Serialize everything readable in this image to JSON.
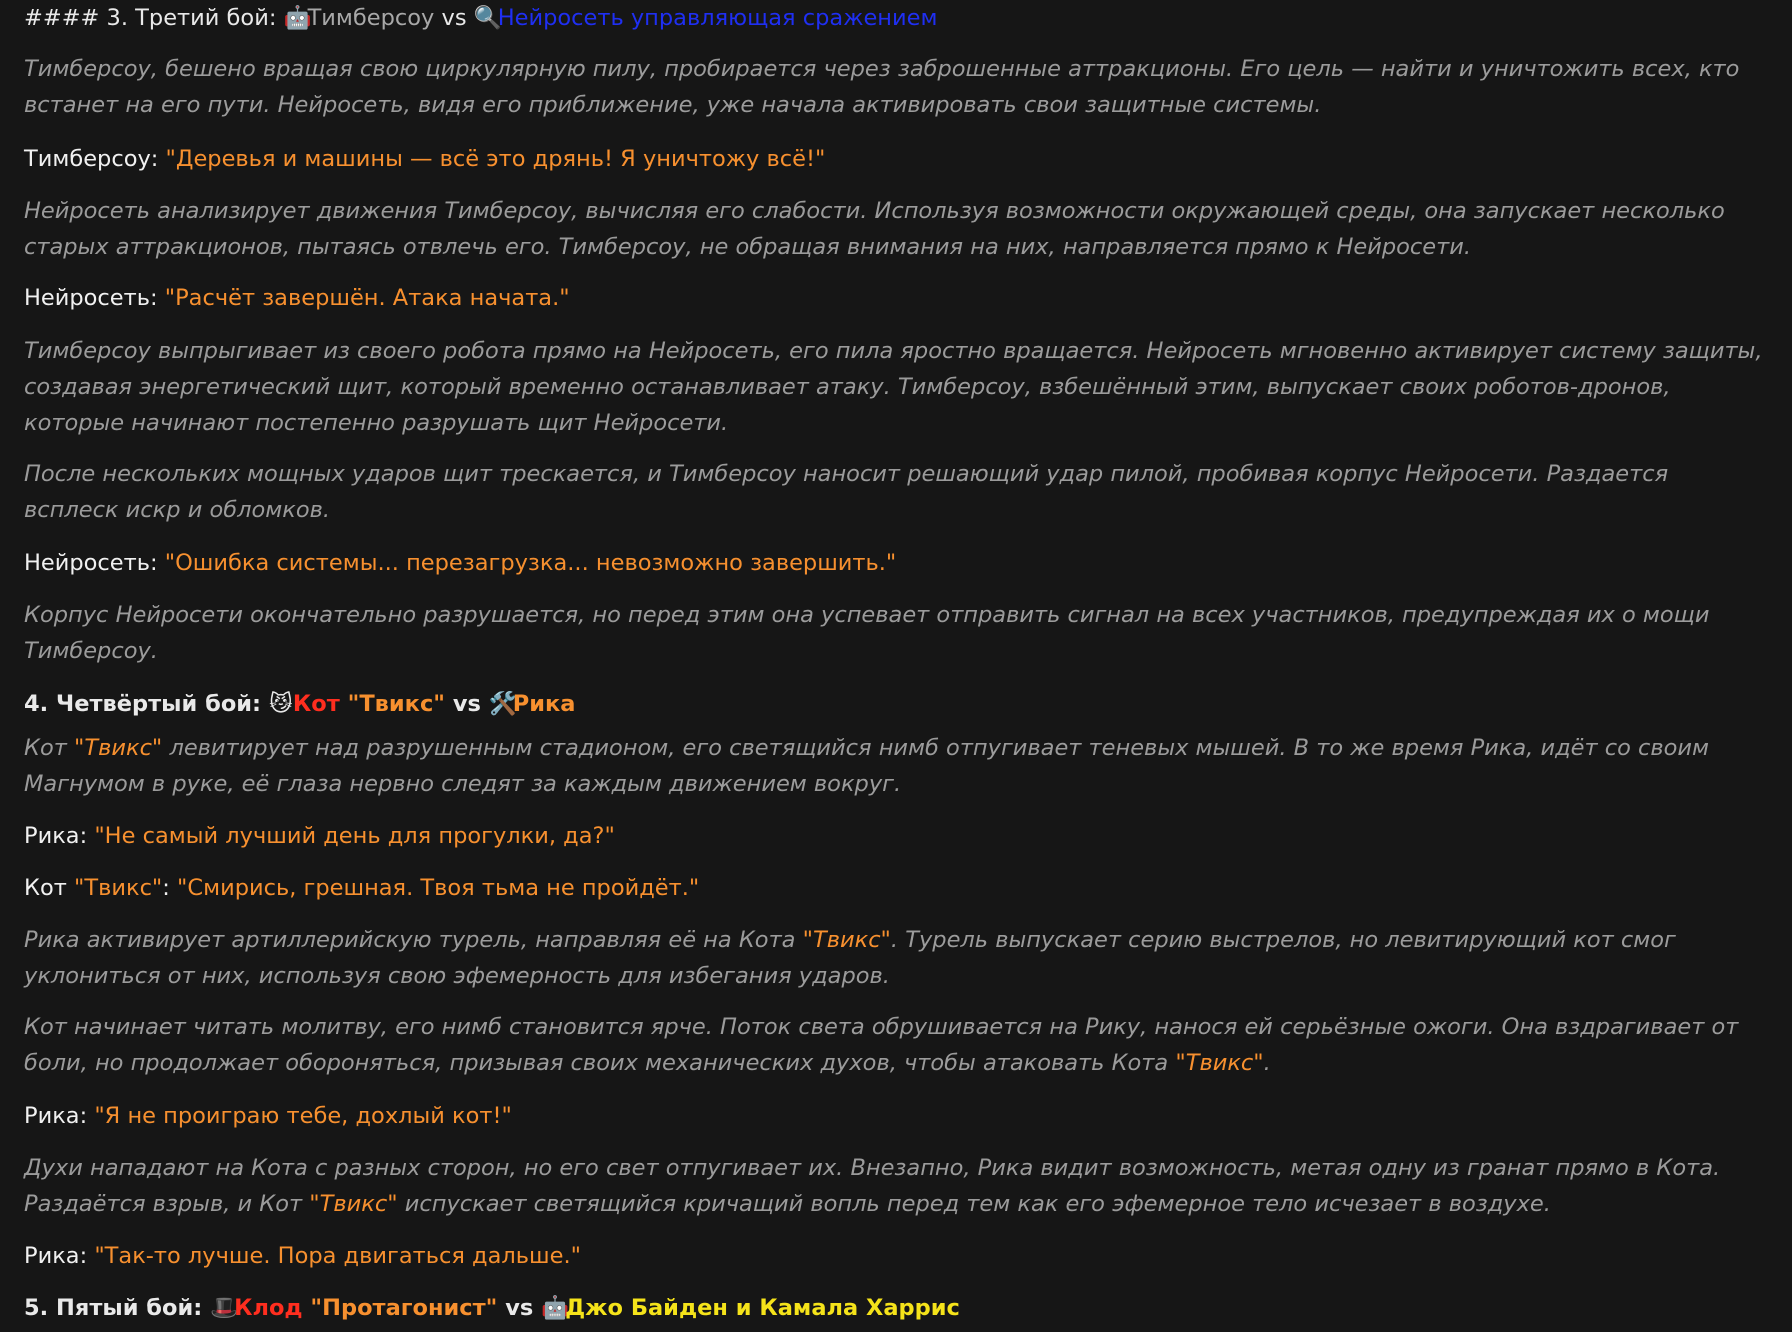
{
  "battle3": {
    "prefix": "#### 3. Третий бой: ",
    "emoji1": "🤖",
    "fighter1": "Тимберсоу",
    "vs": " vs ",
    "emoji2": "🔍",
    "fighter2": "Нейросеть управляющая сражением"
  },
  "p1": "Тимберсоу, бешено вращая свою циркулярную пилу, пробирается через заброшенные аттракционы. Его цель — найти и уничтожить всех, кто встанет на его пути. Нейросеть, видя его приближение, уже начала активировать свои защитные системы.",
  "d1": {
    "speaker": "Тимберсоу: ",
    "quote": "\"Деревья и машины — всё это дрянь! Я уничтожу всё!\""
  },
  "p2": "Нейросеть анализирует движения Тимберсоу, вычисляя его слабости. Используя возможности окружающей среды, она запускает несколько старых аттракционов, пытаясь отвлечь его. Тимберсоу, не обращая внимания на них, направляется прямо к Нейросети.",
  "d2": {
    "speaker": "Нейросеть: ",
    "quote": "\"Расчёт завершён. Атака начата.\""
  },
  "p3": "Тимберсоу выпрыгивает из своего робота прямо на Нейросеть, его пила яростно вращается. Нейросеть мгновенно активирует систему защиты, создавая энергетический щит, который временно останавливает атаку. Тимберсоу, взбешённый этим, выпускает своих роботов-дронов, которые начинают постепенно разрушать щит Нейросети.",
  "p4": "После нескольких мощных ударов щит трескается, и Тимберсоу наносит решающий удар пилой, пробивая корпус Нейросети. Раздается всплеск искр и обломков.",
  "d3": {
    "speaker": "Нейросеть: ",
    "quote": "\"Ошибка системы... перезагрузка... невозможно завершить.\""
  },
  "p5": "Корпус Нейросети окончательно разрушается, но перед этим она успевает отправить сигнал на всех участников, предупреждая их о мощи Тимберсоу.",
  "battle4": {
    "prefix": "4. Четвёртый бой: ",
    "emoji1": "😼",
    "fighter1a": "Кот ",
    "fighter1b": "\"Твикс\"",
    "vs": " vs ",
    "emoji2": "🛠️",
    "fighter2": "Рика"
  },
  "p6": {
    "a": "Кот ",
    "b": "\"Твикс\"",
    "c": " левитирует над разрушенным стадионом, его светящийся нимб отпугивает теневых мышей. В то же время Рика, идёт со своим Магнумом в руке, её глаза нервно следят за каждым движением вокруг."
  },
  "d4": {
    "speaker": "Рика: ",
    "quote": "\"Не самый лучший день для прогулки, да?\""
  },
  "d5": {
    "speaker": "Кот ",
    "name": "\"Твикс\"",
    "colon": ": ",
    "quote": "\"Смирись, грешная. Твоя тьма не пройдёт.\""
  },
  "p7": {
    "a": "Рика активирует артиллерийскую турель, направляя её на Кота ",
    "b": "\"Твикс\"",
    "c": ". Турель выпускает серию выстрелов, но левитирующий кот смог уклониться от них, используя свою эфемерность для избегания ударов."
  },
  "p8": {
    "a": "Кот начинает читать молитву, его нимб становится ярче. Поток света обрушивается на Рику, нанося ей серьёзные ожоги. Она вздрагивает от боли, но продолжает обороняться, призывая своих механических духов, чтобы атаковать Кота ",
    "b": "\"Твикс\"",
    "c": "."
  },
  "d6": {
    "speaker": "Рика: ",
    "quote": "\"Я не проиграю тебе, дохлый кот!\""
  },
  "p9": {
    "a": "Духи нападают на Кота с разных сторон, но его свет отпугивает их. Внезапно, Рика видит возможность, метая одну из гранат прямо в Кота. Раздаётся взрыв, и Кот ",
    "b": "\"Твикс\"",
    "c": " испускает светящийся кричащий вопль перед тем как его эфемерное тело исчезает в воздухе."
  },
  "d7": {
    "speaker": "Рика: ",
    "quote": "\"Так-то лучше. Пора двигаться дальше.\""
  },
  "battle5": {
    "prefix": "5. Пятый бой: ",
    "emoji1": "🎩",
    "fighter1a": "Клод ",
    "fighter1b": "\"Протагонист\"",
    "vs": " vs ",
    "emoji2": "🤖",
    "fighter2": "Джо Байден и Камала Харрис"
  }
}
